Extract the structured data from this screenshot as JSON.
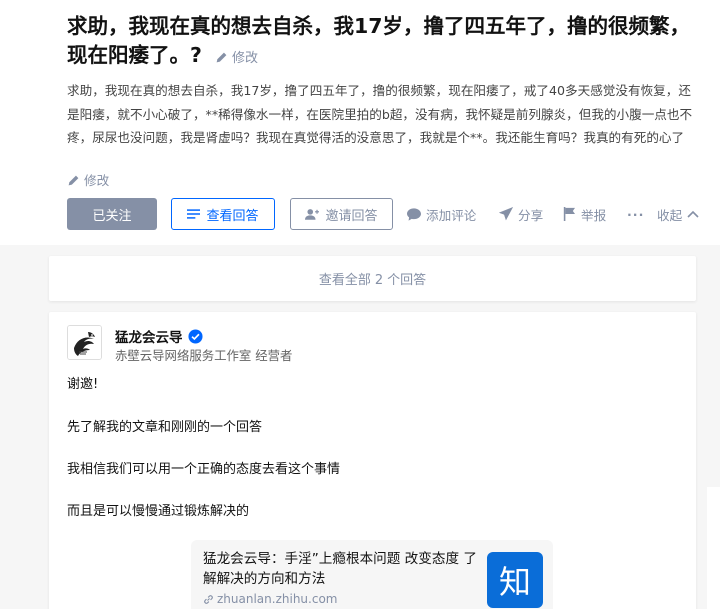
{
  "question": {
    "title": "求助，我现在真的想去自杀，我17岁，撸了四五年了，撸的很频繁，现在阳痿了。?",
    "title_edit": "修改",
    "detail": "求助，我现在真的想去自杀，我17岁，撸了四五年了，撸的很频繁，现在阳痿了，戒了40多天感觉没有恢复，还是阳痿，就不小心破了，**稀得像水一样，在医院里拍的b超，没有病，我怀疑是前列腺炎，但我的小腹一点也不疼，尿尿也没问题，我是肾虚吗？我现在真觉得活的没意思了，我就是个**。我还能生育吗？我真的有死的心了",
    "detail_edit": "修改"
  },
  "actions": {
    "follow": "已关注",
    "view_answer": "查看回答",
    "invite": "邀请回答",
    "comment": "添加评论",
    "share": "分享",
    "report": "举报",
    "more": "···",
    "collapse": "收起"
  },
  "answers_summary": {
    "prefix": "查看全部",
    "count": "2",
    "suffix": "个回答"
  },
  "answer": {
    "author": "猛龙会云导",
    "byline": "赤壁云导网络服务工作室 经营者",
    "paragraphs": [
      "谢邀!",
      "先了解我的文章和刚刚的一个回答",
      "我相信我们可以用一个正确的态度去看这个事情",
      "而且是可以慢慢通过锻炼解决的"
    ],
    "link_card": {
      "title": "猛龙会云导：手淫”上瘾根本问题 改变态度 了解解决的方向和方法",
      "url": "zhuanlan.zhihu.com",
      "icon_text": "知"
    }
  },
  "colors": {
    "accent": "#0066ff",
    "muted": "#8590a6",
    "zhihu_blue": "#0a6dd8"
  }
}
